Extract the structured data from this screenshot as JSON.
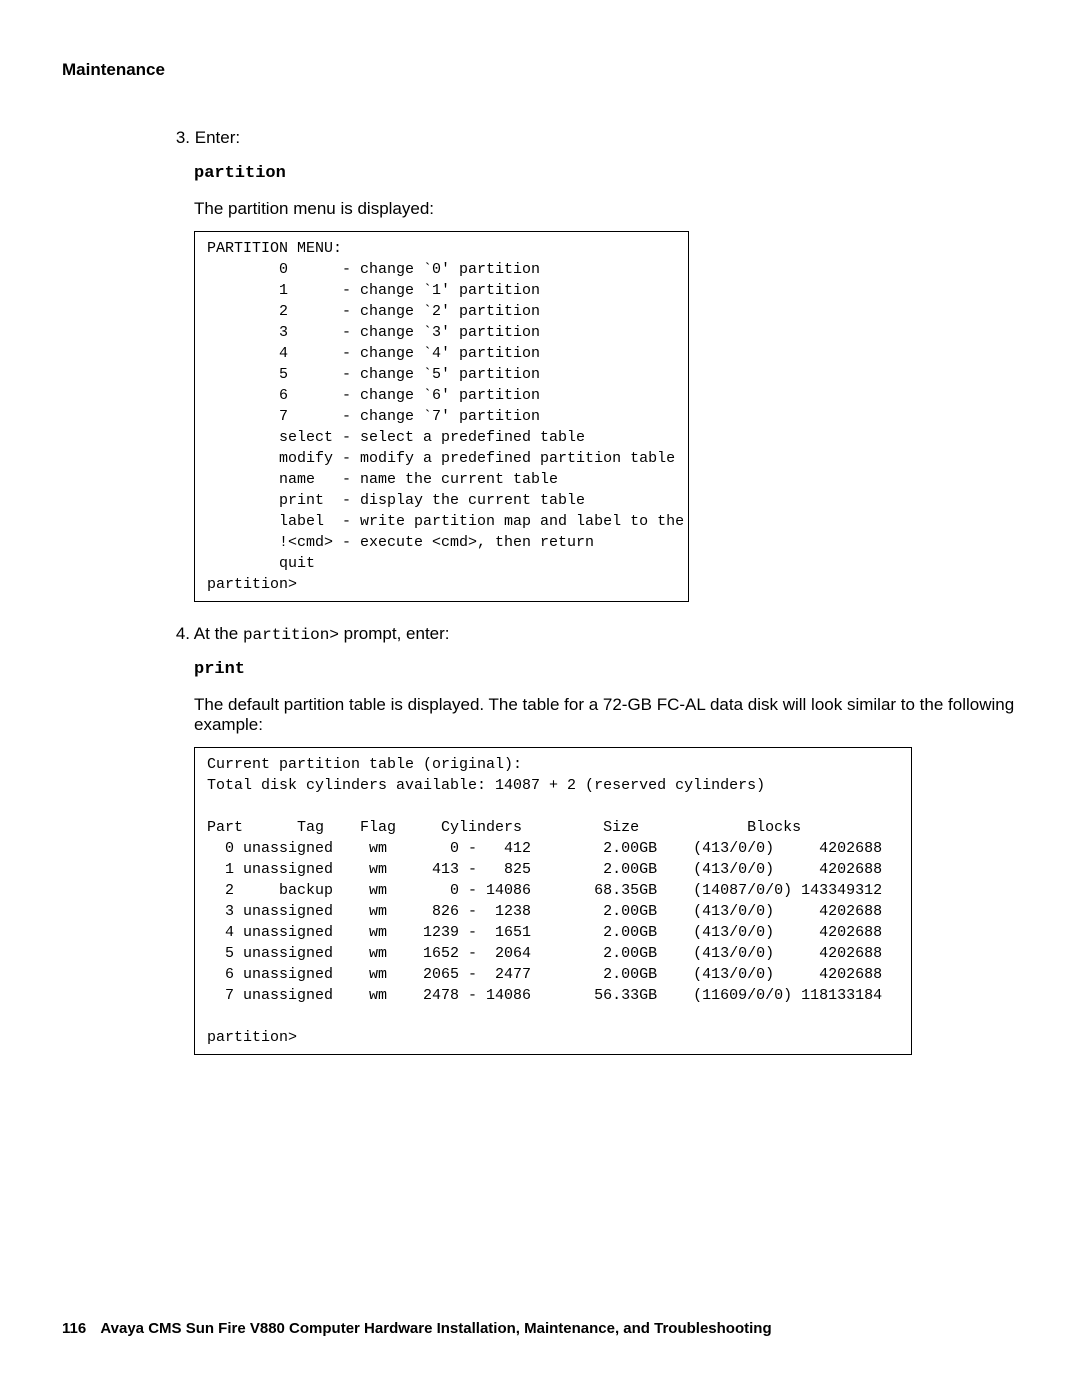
{
  "header": {
    "section": "Maintenance"
  },
  "steps": {
    "s3": {
      "num": "3.",
      "label": "Enter:",
      "command": "partition",
      "follow": "The partition menu is displayed:"
    },
    "s4": {
      "num": "4.",
      "label_prefix": "At the ",
      "prompt_literal": "partition>",
      "label_suffix": " prompt, enter:",
      "command": "print",
      "follow": "The default partition table is displayed. The table for a 72-GB FC-AL data disk will look similar to the following example:"
    }
  },
  "menu_block": "PARTITION MENU:\n        0      - change `0' partition\n        1      - change `1' partition\n        2      - change `2' partition\n        3      - change `3' partition\n        4      - change `4' partition\n        5      - change `5' partition\n        6      - change `6' partition\n        7      - change `7' partition\n        select - select a predefined table\n        modify - modify a predefined partition table\n        name   - name the current table\n        print  - display the current table\n        label  - write partition map and label to the disk\n        !<cmd> - execute <cmd>, then return\n        quit\npartition>",
  "table_block": "Current partition table (original):\nTotal disk cylinders available: 14087 + 2 (reserved cylinders)\n\nPart      Tag    Flag     Cylinders         Size            Blocks\n  0 unassigned    wm       0 -   412        2.00GB    (413/0/0)     4202688\n  1 unassigned    wm     413 -   825        2.00GB    (413/0/0)     4202688\n  2     backup    wm       0 - 14086       68.35GB    (14087/0/0) 143349312\n  3 unassigned    wm     826 -  1238        2.00GB    (413/0/0)     4202688\n  4 unassigned    wm    1239 -  1651        2.00GB    (413/0/0)     4202688\n  5 unassigned    wm    1652 -  2064        2.00GB    (413/0/0)     4202688\n  6 unassigned    wm    2065 -  2477        2.00GB    (413/0/0)     4202688\n  7 unassigned    wm    2478 - 14086       56.33GB    (11609/0/0) 118133184\n\npartition>",
  "footer": {
    "page_number": "116",
    "title": "Avaya CMS Sun Fire V880 Computer Hardware Installation, Maintenance, and Troubleshooting"
  }
}
